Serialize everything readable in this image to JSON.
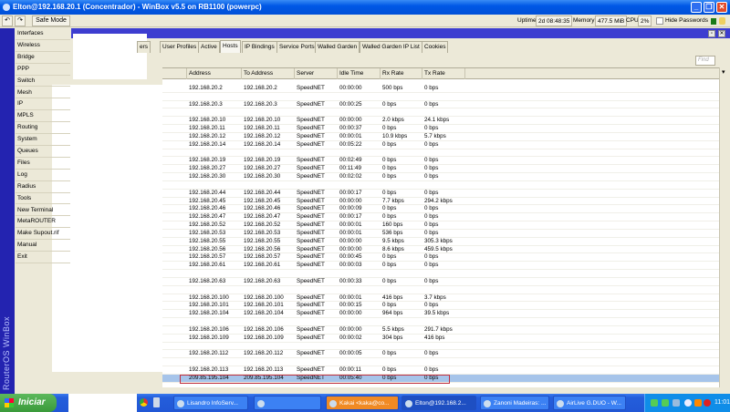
{
  "window": {
    "title": "Elton@192.168.20.1 (Concentrador) - WinBox v5.5 on RB1100 (powerpc)"
  },
  "toolbar": {
    "safe_mode": "Safe Mode",
    "uptime_label": "Uptime:",
    "uptime": "2d 08:48:35",
    "memory_label": "Memory:",
    "memory": "477.5 MiB",
    "cpu_label": "CPU:",
    "cpu": "2%",
    "hide_passwords": "Hide Passwords"
  },
  "sidebar": {
    "brand": "RouterOS WinBox",
    "items": [
      "Interfaces",
      "Wireless",
      "Bridge",
      "PPP",
      "Switch",
      "Mesh",
      "IP",
      "MPLS",
      "Routing",
      "System",
      "Queues",
      "Files",
      "Log",
      "Radius",
      "Tools",
      "New Terminal",
      "MetaROUTER",
      "Make Supout.rif",
      "Manual",
      "Exit"
    ]
  },
  "hotspot": {
    "tabs": [
      "ers",
      "User Profiles",
      "Active",
      "Hosts",
      "IP Bindings",
      "Service Ports",
      "Walled Garden",
      "Walled Garden IP List",
      "Cookies"
    ],
    "active_tab": "Hosts",
    "find_placeholder": "Find",
    "columns": [
      "Address",
      "To Address",
      "Server",
      "Idle Time",
      "Rx Rate",
      "Tx Rate"
    ],
    "rows": [
      [
        "192.168.20.2",
        "192.168.20.2",
        "SpeedNET",
        "00:00:00",
        "500 bps",
        "0 bps"
      ],
      null,
      [
        "192.168.20.3",
        "192.168.20.3",
        "SpeedNET",
        "00:00:25",
        "0 bps",
        "0 bps"
      ],
      null,
      [
        "192.168.20.10",
        "192.168.20.10",
        "SpeedNET",
        "00:00:00",
        "2.0 kbps",
        "24.1 kbps"
      ],
      [
        "192.168.20.11",
        "192.168.20.11",
        "SpeedNET",
        "00:00:37",
        "0 bps",
        "0 bps"
      ],
      [
        "192.168.20.12",
        "192.168.20.12",
        "SpeedNET",
        "00:00:01",
        "10.9 kbps",
        "5.7 kbps"
      ],
      [
        "192.168.20.14",
        "192.168.20.14",
        "SpeedNET",
        "00:05:22",
        "0 bps",
        "0 bps"
      ],
      null,
      [
        "192.168.20.19",
        "192.168.20.19",
        "SpeedNET",
        "00:02:49",
        "0 bps",
        "0 bps"
      ],
      [
        "192.168.20.27",
        "192.168.20.27",
        "SpeedNET",
        "00:11:49",
        "0 bps",
        "0 bps"
      ],
      [
        "192.168.20.30",
        "192.168.20.30",
        "SpeedNET",
        "00:02:02",
        "0 bps",
        "0 bps"
      ],
      null,
      [
        "192.168.20.44",
        "192.168.20.44",
        "SpeedNET",
        "00:00:17",
        "0 bps",
        "0 bps"
      ],
      [
        "192.168.20.45",
        "192.168.20.45",
        "SpeedNET",
        "00:00:00",
        "7.7 kbps",
        "294.2 kbps"
      ],
      [
        "192.168.20.46",
        "192.168.20.46",
        "SpeedNET",
        "00:00:09",
        "0 bps",
        "0 bps"
      ],
      [
        "192.168.20.47",
        "192.168.20.47",
        "SpeedNET",
        "00:00:17",
        "0 bps",
        "0 bps"
      ],
      [
        "192.168.20.52",
        "192.168.20.52",
        "SpeedNET",
        "00:00:01",
        "160 bps",
        "0 bps"
      ],
      [
        "192.168.20.53",
        "192.168.20.53",
        "SpeedNET",
        "00:00:01",
        "536 bps",
        "0 bps"
      ],
      [
        "192.168.20.55",
        "192.168.20.55",
        "SpeedNET",
        "00:00:00",
        "9.5 kbps",
        "305.3 kbps"
      ],
      [
        "192.168.20.56",
        "192.168.20.56",
        "SpeedNET",
        "00:00:00",
        "8.6 kbps",
        "459.5 kbps"
      ],
      [
        "192.168.20.57",
        "192.168.20.57",
        "SpeedNET",
        "00:00:45",
        "0 bps",
        "0 bps"
      ],
      [
        "192.168.20.61",
        "192.168.20.61",
        "SpeedNET",
        "00:00:03",
        "0 bps",
        "0 bps"
      ],
      null,
      [
        "192.168.20.63",
        "192.168.20.63",
        "SpeedNET",
        "00:00:33",
        "0 bps",
        "0 bps"
      ],
      null,
      [
        "192.168.20.100",
        "192.168.20.100",
        "SpeedNET",
        "00:00:01",
        "416 bps",
        "3.7 kbps"
      ],
      [
        "192.168.20.101",
        "192.168.20.101",
        "SpeedNET",
        "00:00:15",
        "0 bps",
        "0 bps"
      ],
      [
        "192.168.20.104",
        "192.168.20.104",
        "SpeedNET",
        "00:00:00",
        "964 bps",
        "39.5 kbps"
      ],
      null,
      [
        "192.168.20.106",
        "192.168.20.106",
        "SpeedNET",
        "00:00:00",
        "5.5 kbps",
        "291.7 kbps"
      ],
      [
        "192.168.20.109",
        "192.168.20.109",
        "SpeedNET",
        "00:00:02",
        "304 bps",
        "416 bps"
      ],
      null,
      [
        "192.168.20.112",
        "192.168.20.112",
        "SpeedNET",
        "00:00:05",
        "0 bps",
        "0 bps"
      ],
      null,
      [
        "192.168.20.113",
        "192.168.20.113",
        "SpeedNET",
        "00:00:11",
        "0 bps",
        "0 bps"
      ],
      [
        "209.85.195.104",
        "209.85.195.104",
        "SpeedNET",
        "00:05:40",
        "0 bps",
        "0 bps"
      ]
    ],
    "selected_row": 36
  },
  "taskbar": {
    "start": "Iniciar",
    "tasks": [
      "Lisandro InfoServ...",
      "",
      "Kakai <kaka@co...",
      "Elton@192.168.2...",
      "Zanoni Madeiras: ...",
      "AirLive G.DUO - W..."
    ],
    "active_task": 3,
    "flashing_task": 2,
    "clock": "11:01"
  }
}
